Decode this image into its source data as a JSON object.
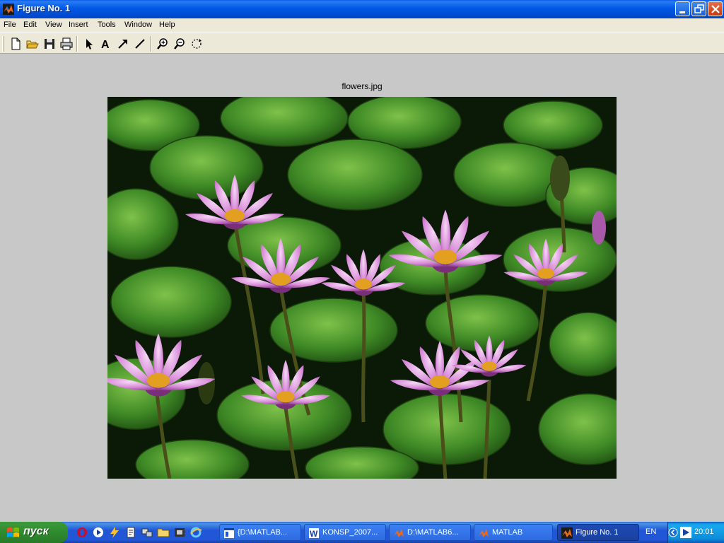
{
  "window": {
    "title": "Figure No. 1"
  },
  "menu": {
    "items": [
      "File",
      "Edit",
      "View",
      "Insert",
      "Tools",
      "Window",
      "Help"
    ]
  },
  "toolbar": {
    "buttons": [
      "new-file-icon",
      "open-folder-icon",
      "save-icon",
      "print-icon",
      "select-arrow-icon",
      "insert-text-icon",
      "insert-arrow-icon",
      "insert-line-icon",
      "zoom-in-icon",
      "zoom-out-icon",
      "rotate-icon"
    ]
  },
  "figure": {
    "title": "flowers.jpg"
  },
  "taskbar": {
    "start_label": "пуск",
    "quick_launch": [
      "opera-icon",
      "media-player-icon",
      "winamp-icon",
      "document-icon",
      "network-icon",
      "folder-icon",
      "film-icon",
      "ie-icon"
    ],
    "tasks": [
      {
        "label": "{D:\\MATLAB..."
      },
      {
        "label": "KONSP_2007..."
      },
      {
        "label": "D:\\MATLAB6..."
      },
      {
        "label": "MATLAB"
      },
      {
        "label": "Figure No. 1"
      }
    ],
    "language": "EN",
    "time": "20:01"
  },
  "colors": {
    "titlebar": "#0058e6",
    "face": "#ece9d8",
    "figure_bg": "#c8c8c8",
    "taskbar": "#2157d7",
    "start": "#2e8b2e"
  }
}
